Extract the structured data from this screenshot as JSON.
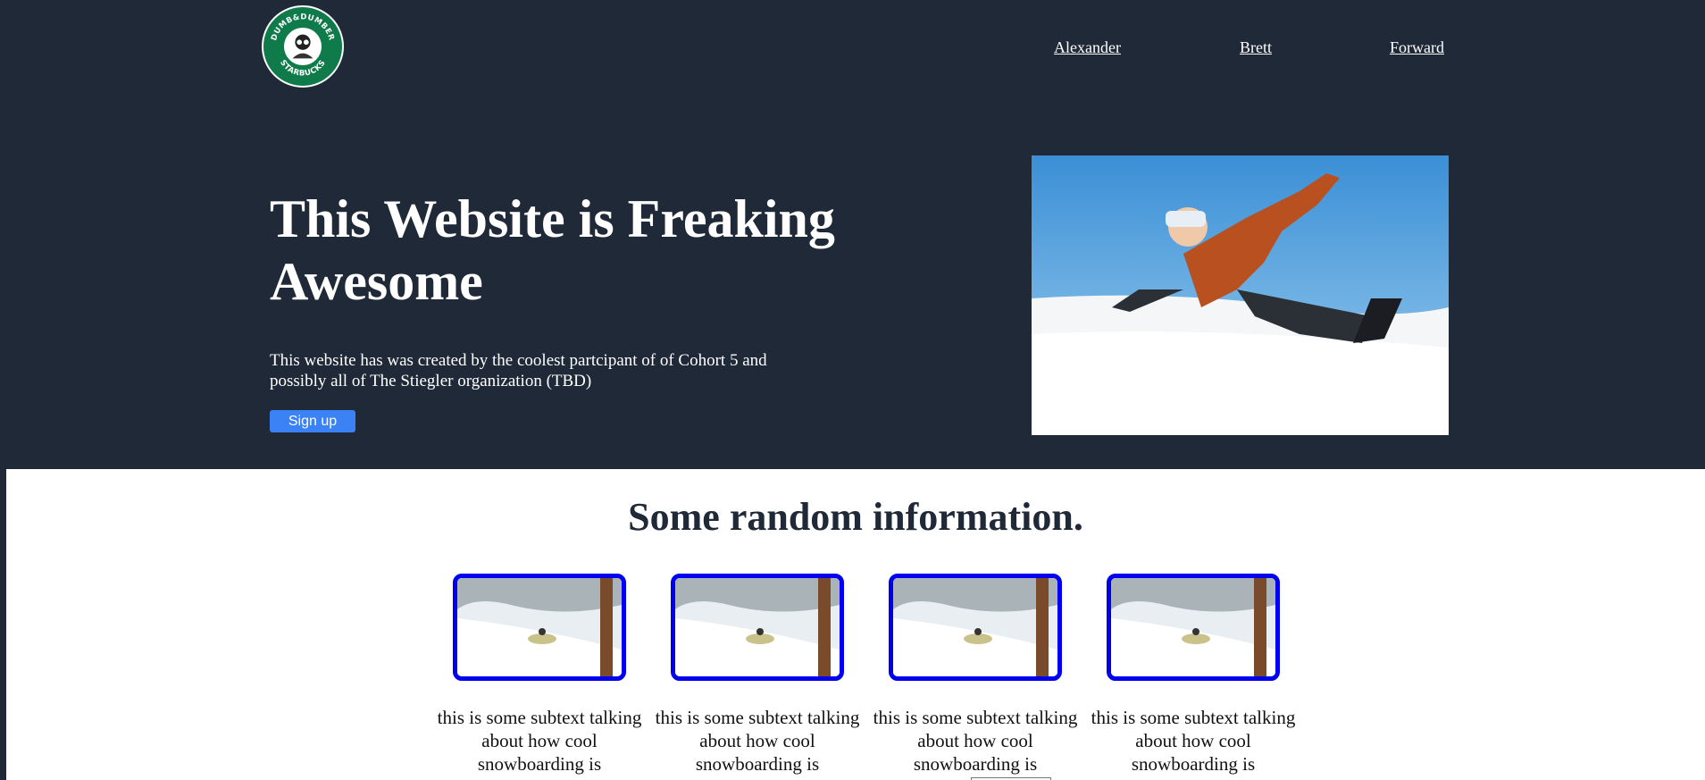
{
  "header": {
    "logo_text": "DUMB & DUMBER STARBUCKS",
    "nav": [
      "Alexander",
      "Brett",
      "Forward"
    ]
  },
  "hero": {
    "title": "This Website is Freaking Awesome",
    "description": "This website has was created by the coolest partcipant of of Cohort 5 and possibly all of The Stiegler organization (TBD)",
    "signup_label": "Sign up"
  },
  "info": {
    "title": "Some random information.",
    "cards": [
      {
        "text": "this is some subtext talking about how cool snowboarding is"
      },
      {
        "text": "this is some subtext talking about how cool snowboarding is"
      },
      {
        "text": "this is some subtext talking about how cool snowboarding is"
      },
      {
        "text": "this is some subtext talking about how cool snowboarding is"
      }
    ]
  },
  "colors": {
    "header_bg": "#1f2937",
    "button": "#3b82f6",
    "card_border": "#0000ee",
    "logo_green": "#0f7a4a"
  }
}
